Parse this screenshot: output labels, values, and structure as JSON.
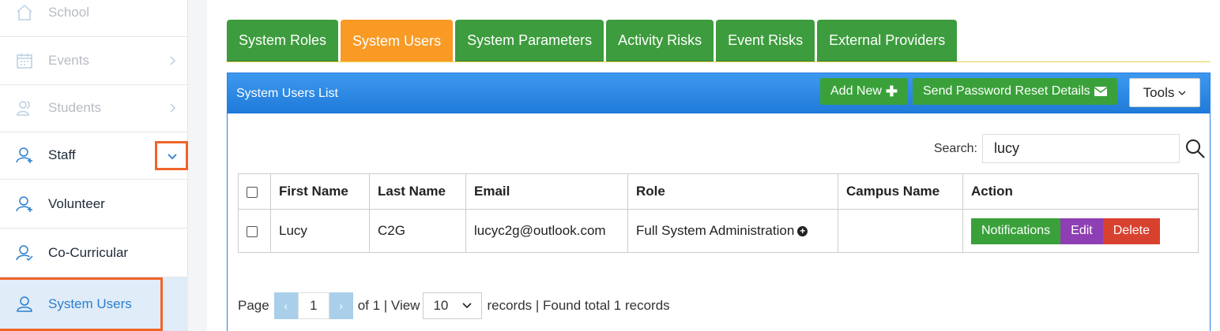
{
  "sidebar": {
    "items": [
      {
        "label": "School",
        "icon": "home-icon"
      },
      {
        "label": "Events",
        "icon": "calendar-icon"
      },
      {
        "label": "Students",
        "icon": "users-icon"
      },
      {
        "label": "Staff",
        "icon": "user-add-icon"
      },
      {
        "label": "Volunteer",
        "icon": "user-add-icon"
      },
      {
        "label": "Co-Curricular",
        "icon": "user-check-icon"
      },
      {
        "label": "System Users",
        "icon": "user-icon"
      }
    ]
  },
  "tabs": [
    "System Roles",
    "System Users",
    "System Parameters",
    "Activity Risks",
    "Event Risks",
    "External Providers"
  ],
  "active_tab": "System Users",
  "panel": {
    "title": "System Users List",
    "add_new": "Add New",
    "send_reset": "Send Password Reset Details",
    "tools": "Tools"
  },
  "search": {
    "label": "Search:",
    "value": "lucy"
  },
  "table": {
    "headers": [
      "First Name",
      "Last Name",
      "Email",
      "Role",
      "Campus Name",
      "Action"
    ],
    "rows": [
      {
        "first": "Lucy",
        "last": "C2G",
        "email": "lucyc2g@outlook.com",
        "role": "Full System Administration",
        "campus": ""
      }
    ],
    "actions": {
      "notifications": "Notifications",
      "edit": "Edit",
      "delete": "Delete"
    }
  },
  "pager": {
    "page_label": "Page",
    "page": "1",
    "of_text": "of 1 | View",
    "per_page": "10",
    "records_text": "records | Found total 1 records"
  },
  "colors": {
    "accent": "#2a7fcf",
    "tab_green": "#3d9c3d",
    "tab_active": "#f99a25",
    "highlight": "#f0642a"
  }
}
